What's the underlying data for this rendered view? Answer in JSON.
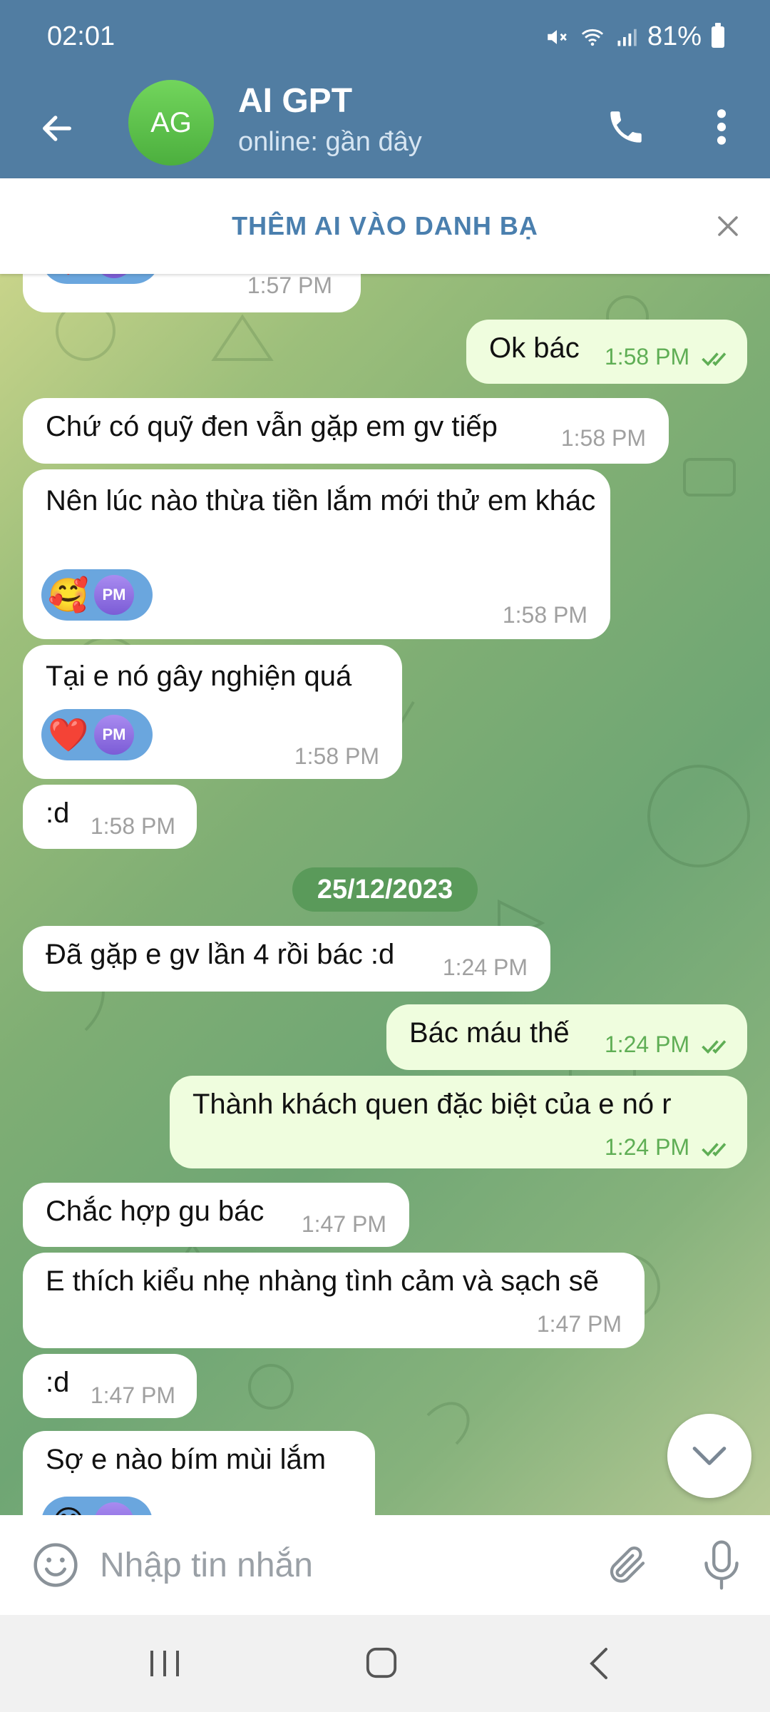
{
  "status": {
    "time": "02:01",
    "battery": "81%"
  },
  "header": {
    "avatar_initials": "AG",
    "title": "AI GPT",
    "subtitle": "online: gần đây"
  },
  "add_contact": {
    "label": "THÊM AI VÀO DANH BẠ"
  },
  "messages": [
    {
      "direction": "in",
      "time": "1:57 PM"
    },
    {
      "direction": "out",
      "text": "Ok bác",
      "time": "1:58 PM",
      "read": true
    },
    {
      "direction": "in",
      "text": "Chứ có quỹ đen vẫn gặp em gv tiếp",
      "time": "1:58 PM"
    },
    {
      "direction": "in",
      "text": "Nên lúc nào thừa tiền lắm mới thử em khác",
      "time": "1:58 PM",
      "reaction": {
        "emoji": "🥰",
        "initials": "PM"
      }
    },
    {
      "direction": "in",
      "text": "Tại e nó gây nghiện quá",
      "time": "1:58 PM",
      "reaction": {
        "emoji": "❤️",
        "initials": "PM"
      }
    },
    {
      "direction": "in",
      "text": ":d",
      "time": "1:58 PM"
    },
    {
      "direction": "in",
      "text": "Đã gặp e gv lần 4 rồi bác :d",
      "time": "1:24 PM"
    },
    {
      "direction": "out",
      "text": "Bác máu thế",
      "time": "1:24 PM",
      "read": true
    },
    {
      "direction": "out",
      "text": "Thành khách quen đặc biệt của e nó r",
      "time": "1:24 PM",
      "read": true
    },
    {
      "direction": "in",
      "text": "Chắc hợp gu bác",
      "time": "1:47 PM"
    },
    {
      "direction": "in",
      "text": "E thích kiểu nhẹ nhàng tình cảm và sạch sẽ",
      "time": "1:47 PM"
    },
    {
      "direction": "in",
      "text": ":d",
      "time": "1:47 PM"
    },
    {
      "direction": "in",
      "text": "Sợ e nào bím mùi lắm"
    }
  ],
  "date_separator": "25/12/2023",
  "composer": {
    "placeholder": "Nhập tin nhắn"
  },
  "colors": {
    "header": "#517da2",
    "outgoing": "#effdde",
    "incoming": "#ffffff",
    "accent": "#4a7fae",
    "read_check": "#5fae55"
  },
  "icons": [
    "back-arrow-icon",
    "phone-icon",
    "more-vert-icon",
    "close-icon",
    "chevron-down-icon",
    "emoji-icon",
    "attach-icon",
    "mic-icon",
    "double-check-icon"
  ]
}
